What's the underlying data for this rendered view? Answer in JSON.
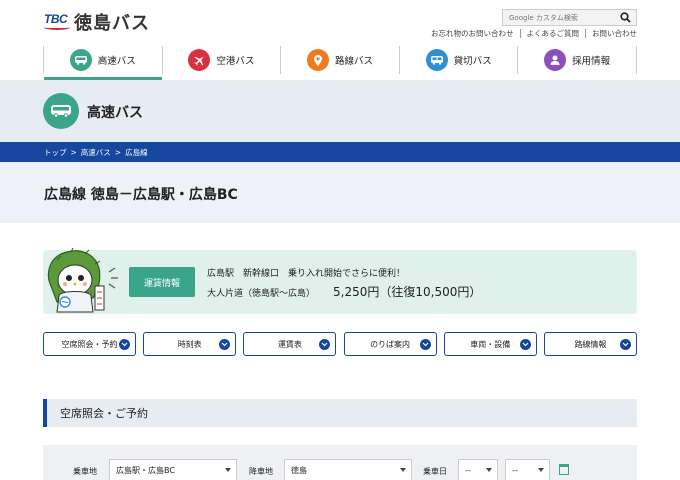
{
  "header": {
    "logo_mark": "TBC",
    "logo_text": "徳島バス",
    "search_placeholder": "Google カスタム検索",
    "util_links": [
      "お忘れ物のお問い合わせ",
      "よくあるご質問",
      "お問い合わせ"
    ]
  },
  "nav": {
    "items": [
      {
        "label": "高速バス",
        "icon": "bus-icon",
        "color": "#3aa58a",
        "active": true
      },
      {
        "label": "空港バス",
        "icon": "airplane-icon",
        "color": "#d8313f",
        "active": false
      },
      {
        "label": "路線バス",
        "icon": "map-pin-icon",
        "color": "#ee7b22",
        "active": false
      },
      {
        "label": "貸切バス",
        "icon": "charter-bus-icon",
        "color": "#2d8fd5",
        "active": false
      },
      {
        "label": "採用情報",
        "icon": "person-icon",
        "color": "#8c4fbf",
        "active": false
      }
    ]
  },
  "category": {
    "title": "高速バス",
    "icon": "bus-icon"
  },
  "breadcrumb": [
    "トップ",
    "高速バス",
    "広島線"
  ],
  "route": {
    "title": "広島線 徳島－広島駅・広島BC"
  },
  "info": {
    "button_label": "運賃情報",
    "line1": "広島駅　新幹線口　乗り入れ開始でさらに便利！",
    "line2_label": "大人片道（徳島駅〜広島）",
    "line2_price": "5,250円（往復10,500円）"
  },
  "tabs": [
    "空席照会・予約",
    "時刻表",
    "運賃表",
    "のりば案内",
    "車両・設備",
    "路線情報"
  ],
  "reservation": {
    "heading": "空席照会・ご予約",
    "boarding_label": "乗車地",
    "boarding_value": "広島駅・広島BC",
    "alighting_label": "降車地",
    "alighting_value": "徳島",
    "date_label": "乗車日",
    "date_month": "--",
    "date_day": "--"
  },
  "colors": {
    "navy": "#14479d",
    "green": "#3aa58a",
    "light_band": "#e7ebf2"
  }
}
